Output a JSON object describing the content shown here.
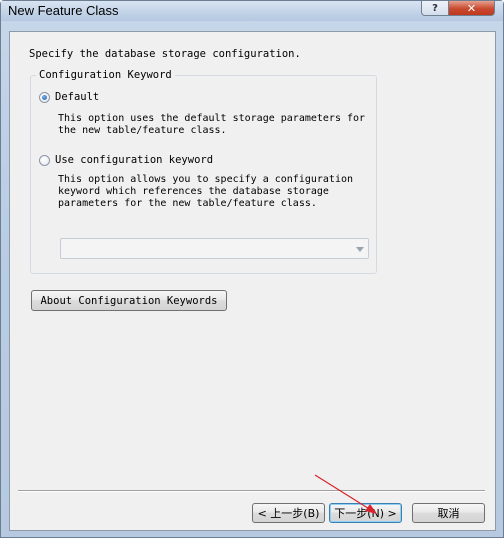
{
  "window": {
    "title": "New Feature Class",
    "help_glyph": "?",
    "close_glyph": "✕"
  },
  "page": {
    "intro": "Specify the database storage configuration."
  },
  "group": {
    "legend": "Configuration Keyword",
    "default_option": {
      "label": "Default",
      "checked": true,
      "description": [
        "This option uses the default storage parameters for",
        "the new table/feature class."
      ]
    },
    "keyword_option": {
      "label": "Use configuration keyword",
      "checked": false,
      "description": [
        "This option allows you to specify a configuration",
        "keyword which references the database storage",
        "parameters for the new table/feature class."
      ]
    },
    "keyword_combo": {
      "value": ""
    }
  },
  "about_button": {
    "label": "About Configuration Keywords"
  },
  "footer": {
    "back_label": "< 上一步(B)",
    "next_label": "下一步(N) >",
    "cancel_label": "取消"
  },
  "colors": {
    "annotation_arrow": "#d9232d",
    "close_button": "#c84a30",
    "selected_radio": "#1c5aa8"
  },
  "icons": {
    "help": "help-icon",
    "close": "close-icon",
    "dropdown": "chevron-down-icon"
  }
}
